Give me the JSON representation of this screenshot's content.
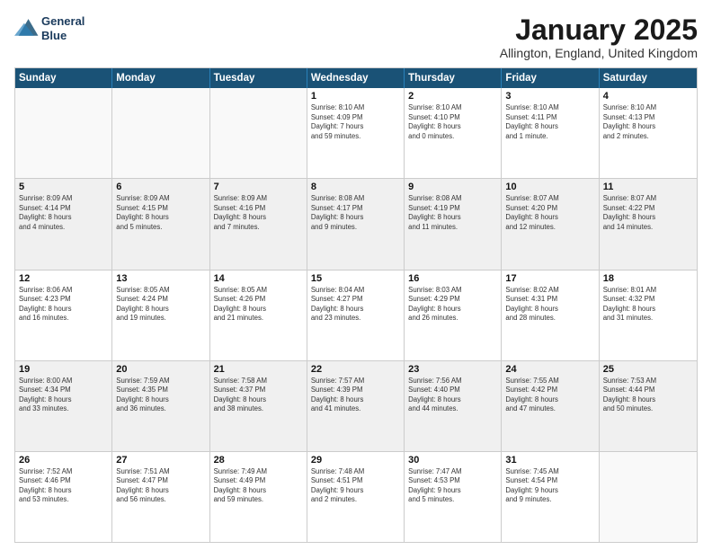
{
  "logo": {
    "line1": "General",
    "line2": "Blue"
  },
  "title": "January 2025",
  "location": "Allington, England, United Kingdom",
  "weekdays": [
    "Sunday",
    "Monday",
    "Tuesday",
    "Wednesday",
    "Thursday",
    "Friday",
    "Saturday"
  ],
  "rows": [
    {
      "shaded": false,
      "cells": [
        {
          "day": "",
          "info": ""
        },
        {
          "day": "",
          "info": ""
        },
        {
          "day": "",
          "info": ""
        },
        {
          "day": "1",
          "info": "Sunrise: 8:10 AM\nSunset: 4:09 PM\nDaylight: 7 hours\nand 59 minutes."
        },
        {
          "day": "2",
          "info": "Sunrise: 8:10 AM\nSunset: 4:10 PM\nDaylight: 8 hours\nand 0 minutes."
        },
        {
          "day": "3",
          "info": "Sunrise: 8:10 AM\nSunset: 4:11 PM\nDaylight: 8 hours\nand 1 minute."
        },
        {
          "day": "4",
          "info": "Sunrise: 8:10 AM\nSunset: 4:13 PM\nDaylight: 8 hours\nand 2 minutes."
        }
      ]
    },
    {
      "shaded": true,
      "cells": [
        {
          "day": "5",
          "info": "Sunrise: 8:09 AM\nSunset: 4:14 PM\nDaylight: 8 hours\nand 4 minutes."
        },
        {
          "day": "6",
          "info": "Sunrise: 8:09 AM\nSunset: 4:15 PM\nDaylight: 8 hours\nand 5 minutes."
        },
        {
          "day": "7",
          "info": "Sunrise: 8:09 AM\nSunset: 4:16 PM\nDaylight: 8 hours\nand 7 minutes."
        },
        {
          "day": "8",
          "info": "Sunrise: 8:08 AM\nSunset: 4:17 PM\nDaylight: 8 hours\nand 9 minutes."
        },
        {
          "day": "9",
          "info": "Sunrise: 8:08 AM\nSunset: 4:19 PM\nDaylight: 8 hours\nand 11 minutes."
        },
        {
          "day": "10",
          "info": "Sunrise: 8:07 AM\nSunset: 4:20 PM\nDaylight: 8 hours\nand 12 minutes."
        },
        {
          "day": "11",
          "info": "Sunrise: 8:07 AM\nSunset: 4:22 PM\nDaylight: 8 hours\nand 14 minutes."
        }
      ]
    },
    {
      "shaded": false,
      "cells": [
        {
          "day": "12",
          "info": "Sunrise: 8:06 AM\nSunset: 4:23 PM\nDaylight: 8 hours\nand 16 minutes."
        },
        {
          "day": "13",
          "info": "Sunrise: 8:05 AM\nSunset: 4:24 PM\nDaylight: 8 hours\nand 19 minutes."
        },
        {
          "day": "14",
          "info": "Sunrise: 8:05 AM\nSunset: 4:26 PM\nDaylight: 8 hours\nand 21 minutes."
        },
        {
          "day": "15",
          "info": "Sunrise: 8:04 AM\nSunset: 4:27 PM\nDaylight: 8 hours\nand 23 minutes."
        },
        {
          "day": "16",
          "info": "Sunrise: 8:03 AM\nSunset: 4:29 PM\nDaylight: 8 hours\nand 26 minutes."
        },
        {
          "day": "17",
          "info": "Sunrise: 8:02 AM\nSunset: 4:31 PM\nDaylight: 8 hours\nand 28 minutes."
        },
        {
          "day": "18",
          "info": "Sunrise: 8:01 AM\nSunset: 4:32 PM\nDaylight: 8 hours\nand 31 minutes."
        }
      ]
    },
    {
      "shaded": true,
      "cells": [
        {
          "day": "19",
          "info": "Sunrise: 8:00 AM\nSunset: 4:34 PM\nDaylight: 8 hours\nand 33 minutes."
        },
        {
          "day": "20",
          "info": "Sunrise: 7:59 AM\nSunset: 4:35 PM\nDaylight: 8 hours\nand 36 minutes."
        },
        {
          "day": "21",
          "info": "Sunrise: 7:58 AM\nSunset: 4:37 PM\nDaylight: 8 hours\nand 38 minutes."
        },
        {
          "day": "22",
          "info": "Sunrise: 7:57 AM\nSunset: 4:39 PM\nDaylight: 8 hours\nand 41 minutes."
        },
        {
          "day": "23",
          "info": "Sunrise: 7:56 AM\nSunset: 4:40 PM\nDaylight: 8 hours\nand 44 minutes."
        },
        {
          "day": "24",
          "info": "Sunrise: 7:55 AM\nSunset: 4:42 PM\nDaylight: 8 hours\nand 47 minutes."
        },
        {
          "day": "25",
          "info": "Sunrise: 7:53 AM\nSunset: 4:44 PM\nDaylight: 8 hours\nand 50 minutes."
        }
      ]
    },
    {
      "shaded": false,
      "cells": [
        {
          "day": "26",
          "info": "Sunrise: 7:52 AM\nSunset: 4:46 PM\nDaylight: 8 hours\nand 53 minutes."
        },
        {
          "day": "27",
          "info": "Sunrise: 7:51 AM\nSunset: 4:47 PM\nDaylight: 8 hours\nand 56 minutes."
        },
        {
          "day": "28",
          "info": "Sunrise: 7:49 AM\nSunset: 4:49 PM\nDaylight: 8 hours\nand 59 minutes."
        },
        {
          "day": "29",
          "info": "Sunrise: 7:48 AM\nSunset: 4:51 PM\nDaylight: 9 hours\nand 2 minutes."
        },
        {
          "day": "30",
          "info": "Sunrise: 7:47 AM\nSunset: 4:53 PM\nDaylight: 9 hours\nand 5 minutes."
        },
        {
          "day": "31",
          "info": "Sunrise: 7:45 AM\nSunset: 4:54 PM\nDaylight: 9 hours\nand 9 minutes."
        },
        {
          "day": "",
          "info": ""
        }
      ]
    }
  ]
}
